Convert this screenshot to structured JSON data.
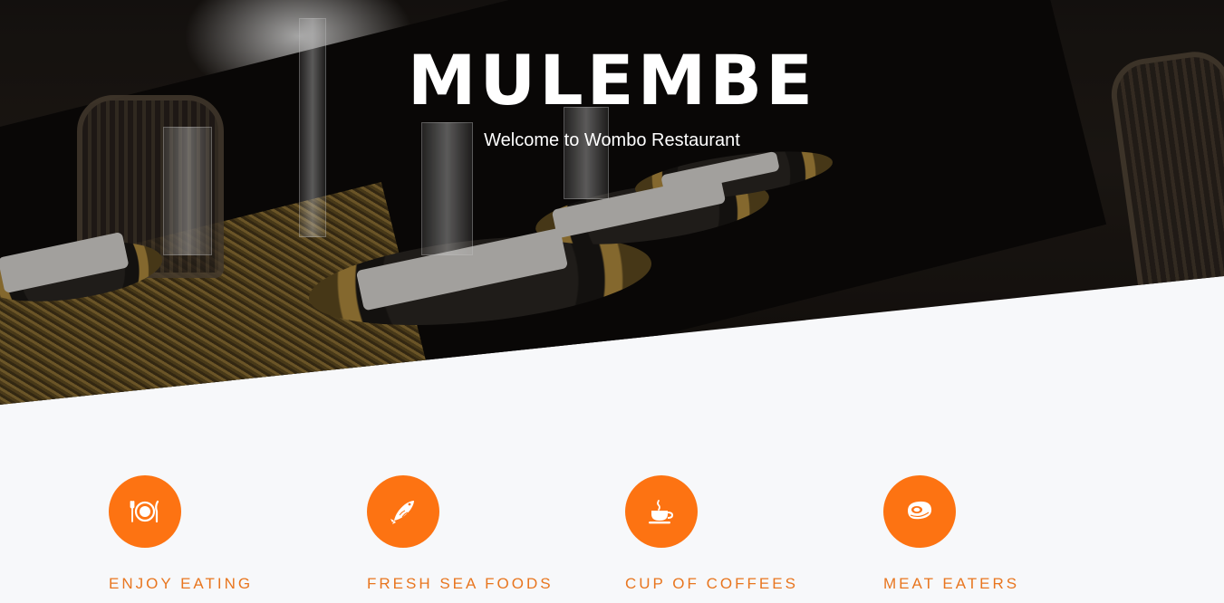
{
  "hero": {
    "title": "MULEMBE",
    "subtitle": "Welcome to Wombo Restaurant"
  },
  "features": [
    {
      "label": "ENJOY EATING",
      "icon": "plate-cutlery-icon"
    },
    {
      "label": "FRESH SEA FOODS",
      "icon": "fish-icon"
    },
    {
      "label": "CUP OF COFFEES",
      "icon": "coffee-cup-icon"
    },
    {
      "label": "MEAT EATERS",
      "icon": "steak-icon"
    }
  ],
  "colors": {
    "accent": "#fd7312",
    "accent_text": "#e8761f",
    "page_background": "#f7f8fa",
    "hero_text": "#ffffff"
  }
}
